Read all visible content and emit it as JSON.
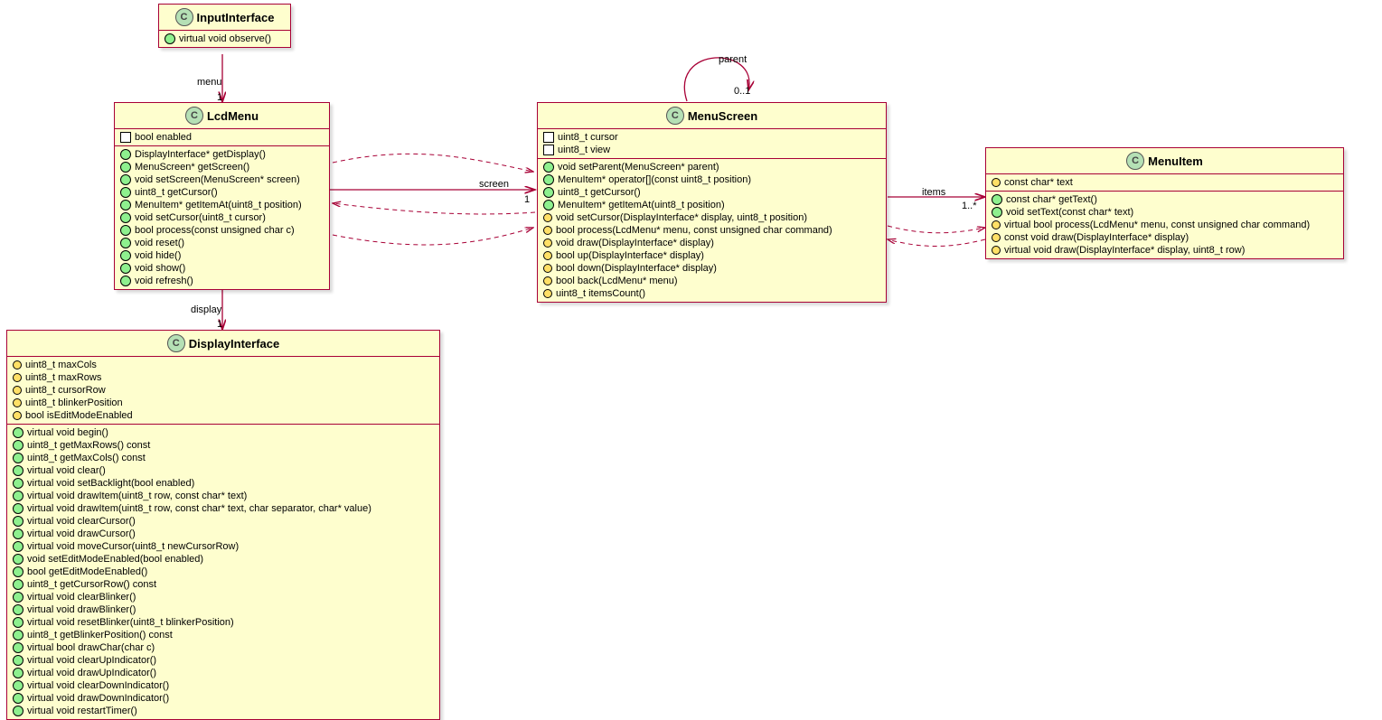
{
  "classes": {
    "InputInterface": {
      "name": "InputInterface",
      "methods": [
        {
          "vis": "public",
          "sig": "virtual void observe()"
        }
      ]
    },
    "LcdMenu": {
      "name": "LcdMenu",
      "fields": [
        {
          "vis": "private",
          "sig": "bool enabled"
        }
      ],
      "methods": [
        {
          "vis": "public",
          "sig": "DisplayInterface* getDisplay()"
        },
        {
          "vis": "public",
          "sig": "MenuScreen* getScreen()"
        },
        {
          "vis": "public",
          "sig": "void setScreen(MenuScreen* screen)"
        },
        {
          "vis": "public",
          "sig": "uint8_t getCursor()"
        },
        {
          "vis": "public",
          "sig": "MenuItem* getItemAt(uint8_t position)"
        },
        {
          "vis": "public",
          "sig": "void setCursor(uint8_t cursor)"
        },
        {
          "vis": "public",
          "sig": "bool process(const unsigned char c)"
        },
        {
          "vis": "public",
          "sig": "void reset()"
        },
        {
          "vis": "public",
          "sig": "void hide()"
        },
        {
          "vis": "public",
          "sig": "void show()"
        },
        {
          "vis": "public",
          "sig": "void refresh()"
        }
      ]
    },
    "MenuScreen": {
      "name": "MenuScreen",
      "fields": [
        {
          "vis": "private",
          "sig": "uint8_t cursor"
        },
        {
          "vis": "private",
          "sig": "uint8_t view"
        }
      ],
      "methods": [
        {
          "vis": "public",
          "sig": "void setParent(MenuScreen* parent)"
        },
        {
          "vis": "public",
          "sig": "MenuItem* operator[](const uint8_t position)"
        },
        {
          "vis": "public",
          "sig": "uint8_t getCursor()"
        },
        {
          "vis": "public",
          "sig": "MenuItem* getItemAt(uint8_t position)"
        },
        {
          "vis": "protected",
          "sig": "void setCursor(DisplayInterface* display, uint8_t position)"
        },
        {
          "vis": "protected",
          "sig": "bool process(LcdMenu* menu, const unsigned char command)"
        },
        {
          "vis": "protected",
          "sig": "void draw(DisplayInterface* display)"
        },
        {
          "vis": "protected",
          "sig": "bool up(DisplayInterface* display)"
        },
        {
          "vis": "protected",
          "sig": "bool down(DisplayInterface* display)"
        },
        {
          "vis": "protected",
          "sig": "bool back(LcdMenu* menu)"
        },
        {
          "vis": "protected",
          "sig": "uint8_t itemsCount()"
        }
      ]
    },
    "MenuItem": {
      "name": "MenuItem",
      "fields": [
        {
          "vis": "protected",
          "sig": "const char* text"
        }
      ],
      "methods": [
        {
          "vis": "public",
          "sig": "const char* getText()"
        },
        {
          "vis": "public",
          "sig": "void setText(const char* text)"
        },
        {
          "vis": "protected",
          "sig": "virtual bool process(LcdMenu* menu, const unsigned char command)"
        },
        {
          "vis": "protected",
          "sig": "const void draw(DisplayInterface* display)"
        },
        {
          "vis": "protected",
          "sig": "virtual void draw(DisplayInterface* display, uint8_t row)"
        }
      ]
    },
    "DisplayInterface": {
      "name": "DisplayInterface",
      "fields": [
        {
          "vis": "protected",
          "sig": "uint8_t maxCols"
        },
        {
          "vis": "protected",
          "sig": "uint8_t maxRows"
        },
        {
          "vis": "protected",
          "sig": "uint8_t cursorRow"
        },
        {
          "vis": "protected",
          "sig": "uint8_t blinkerPosition"
        },
        {
          "vis": "protected",
          "sig": "bool isEditModeEnabled"
        }
      ],
      "methods": [
        {
          "vis": "public",
          "sig": "virtual void begin()"
        },
        {
          "vis": "public",
          "sig": "uint8_t getMaxRows() const"
        },
        {
          "vis": "public",
          "sig": "uint8_t getMaxCols() const"
        },
        {
          "vis": "public",
          "sig": "virtual void clear()"
        },
        {
          "vis": "public",
          "sig": "virtual void setBacklight(bool enabled)"
        },
        {
          "vis": "public",
          "sig": "virtual void drawItem(uint8_t row, const char* text)"
        },
        {
          "vis": "public",
          "sig": "virtual void drawItem(uint8_t row, const char* text, char separator, char* value)"
        },
        {
          "vis": "public",
          "sig": "virtual void clearCursor()"
        },
        {
          "vis": "public",
          "sig": "virtual void drawCursor()"
        },
        {
          "vis": "public",
          "sig": "virtual void moveCursor(uint8_t newCursorRow)"
        },
        {
          "vis": "public",
          "sig": "void setEditModeEnabled(bool enabled)"
        },
        {
          "vis": "public",
          "sig": "bool getEditModeEnabled()"
        },
        {
          "vis": "public",
          "sig": "uint8_t getCursorRow() const"
        },
        {
          "vis": "public",
          "sig": "virtual void clearBlinker()"
        },
        {
          "vis": "public",
          "sig": "virtual void drawBlinker()"
        },
        {
          "vis": "public",
          "sig": "virtual void resetBlinker(uint8_t blinkerPosition)"
        },
        {
          "vis": "public",
          "sig": "uint8_t getBlinkerPosition() const"
        },
        {
          "vis": "public",
          "sig": "virtual bool drawChar(char c)"
        },
        {
          "vis": "public",
          "sig": "virtual void clearUpIndicator()"
        },
        {
          "vis": "public",
          "sig": "virtual void drawUpIndicator()"
        },
        {
          "vis": "public",
          "sig": "virtual void clearDownIndicator()"
        },
        {
          "vis": "public",
          "sig": "virtual void drawDownIndicator()"
        },
        {
          "vis": "public",
          "sig": "virtual void restartTimer()"
        }
      ]
    }
  },
  "relations": {
    "menu": {
      "label": "menu",
      "mult": "1"
    },
    "screen": {
      "label": "screen",
      "mult": "1"
    },
    "display": {
      "label": "display",
      "mult": "1"
    },
    "items": {
      "label": "items",
      "mult": "1..*"
    },
    "parent": {
      "label": "parent",
      "mult": "0..1"
    }
  }
}
